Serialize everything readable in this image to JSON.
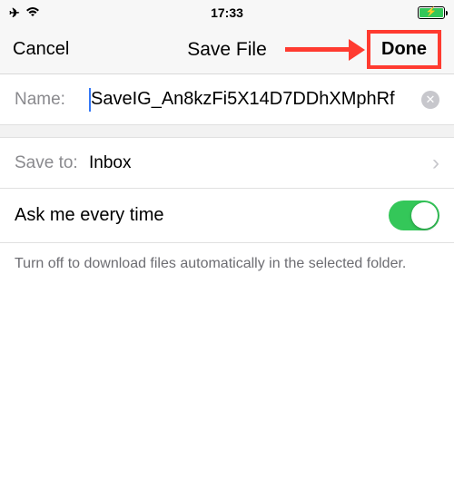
{
  "status": {
    "time": "17:33"
  },
  "nav": {
    "cancel": "Cancel",
    "title": "Save File",
    "done": "Done"
  },
  "nameRow": {
    "label": "Name:",
    "value": "SaveIG_An8kzFi5X14D7DDhXMphRf"
  },
  "saveToRow": {
    "label": "Save to:",
    "value": "Inbox"
  },
  "toggleRow": {
    "label": "Ask me every time"
  },
  "footer": {
    "text": "Turn off to download files automatically in the selected folder."
  },
  "annotation": {
    "color": "#ff3b30"
  }
}
